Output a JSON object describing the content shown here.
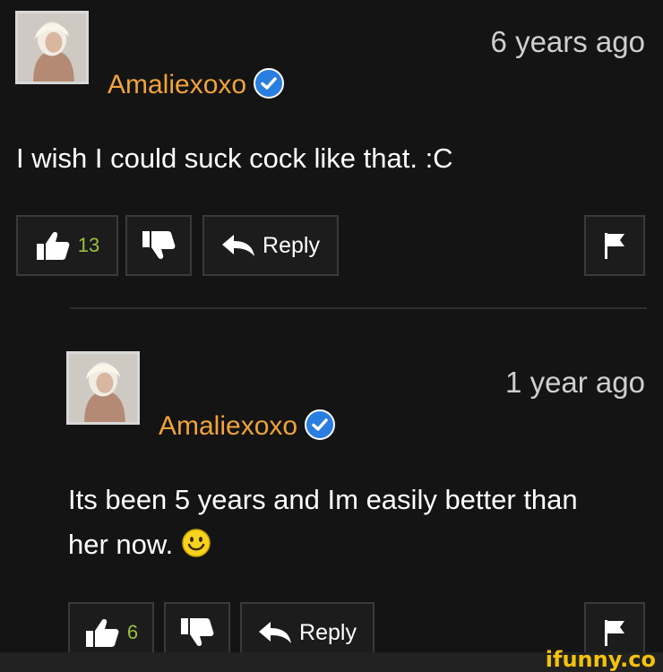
{
  "comments": [
    {
      "username": "Amaliexoxo",
      "timestamp": "6 years ago",
      "text": "I wish I could suck cock like that. :C",
      "likes": "13",
      "reply_label": "Reply"
    },
    {
      "username": "Amaliexoxo",
      "timestamp": "1 year ago",
      "text": "Its been 5 years and Im easily better than her now.",
      "likes": "6",
      "reply_label": "Reply"
    }
  ],
  "icons": {
    "verified": "verified-check-icon",
    "like": "thumbs-up-icon",
    "dislike": "thumbs-down-icon",
    "reply": "reply-arrow-icon",
    "flag": "flag-icon",
    "emoji": "smiley-icon"
  },
  "colors": {
    "background": "#141414",
    "username": "#f0a33a",
    "like_count": "#9bbf3a",
    "verified": "#2a7de1"
  },
  "watermark": "ifunny.co"
}
